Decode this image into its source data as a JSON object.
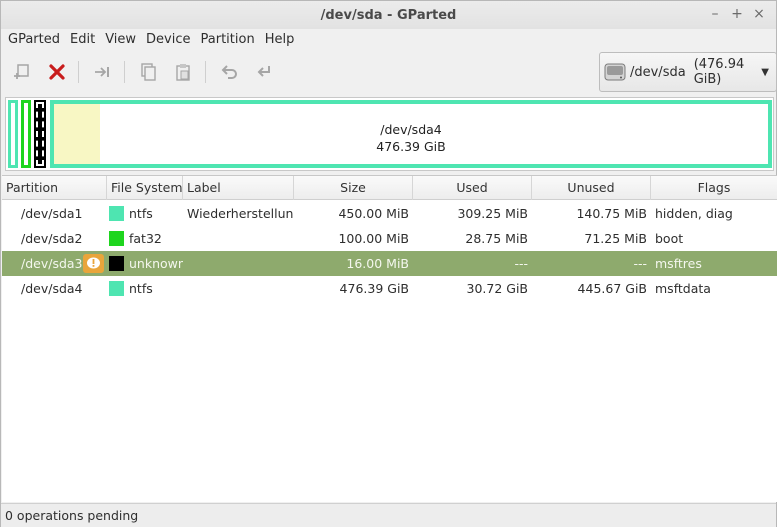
{
  "window": {
    "title": "/dev/sda - GParted"
  },
  "menu": [
    "GParted",
    "Edit",
    "View",
    "Device",
    "Partition",
    "Help"
  ],
  "device_selector": {
    "device": "/dev/sda",
    "size": "(476.94 GiB)"
  },
  "partition_map": {
    "selected_name": "/dev/sda4",
    "selected_size": "476.39 GiB"
  },
  "table": {
    "headers": [
      "Partition",
      "File System",
      "Label",
      "Size",
      "Used",
      "Unused",
      "Flags"
    ],
    "rows": [
      {
        "partition": "/dev/sda1",
        "fs_color": "#4ee5b1",
        "filesystem": "ntfs",
        "label": "Wiederherstellung",
        "size": "450.00 MiB",
        "used": "309.25 MiB",
        "unused": "140.75 MiB",
        "flags": "hidden, diag",
        "warning": false,
        "selected": false
      },
      {
        "partition": "/dev/sda2",
        "fs_color": "#1ed51e",
        "filesystem": "fat32",
        "label": "",
        "size": "100.00 MiB",
        "used": "28.75 MiB",
        "unused": "71.25 MiB",
        "flags": "boot",
        "warning": false,
        "selected": false
      },
      {
        "partition": "/dev/sda3",
        "fs_color": "#000000",
        "filesystem": "unknown",
        "label": "",
        "size": "16.00 MiB",
        "used": "---",
        "unused": "---",
        "flags": "msftres",
        "warning": true,
        "selected": true
      },
      {
        "partition": "/dev/sda4",
        "fs_color": "#4ee5b1",
        "filesystem": "ntfs",
        "label": "",
        "size": "476.39 GiB",
        "used": "30.72 GiB",
        "unused": "445.67 GiB",
        "flags": "msftdata",
        "warning": false,
        "selected": false
      }
    ]
  },
  "status": "0 operations pending",
  "colors": {
    "ntfs": "#4ee5b1",
    "fat32": "#1ed51e",
    "selection": "#8eaa6d",
    "used_space": "#f8f7c4"
  }
}
